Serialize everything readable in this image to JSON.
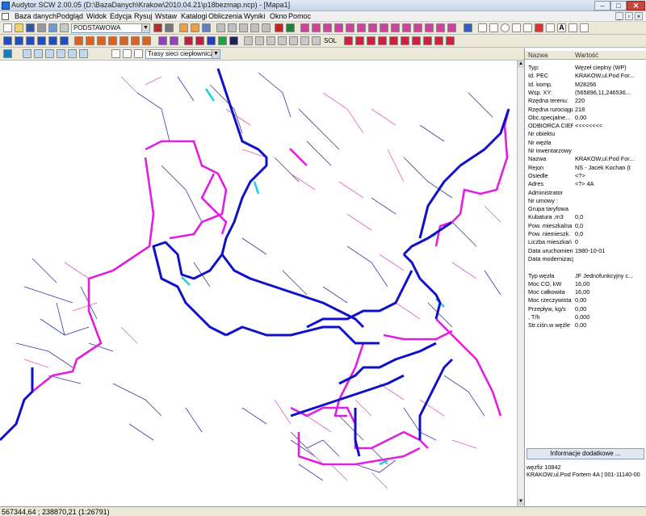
{
  "window": {
    "title": "Audytor SCW  2.00.05   (D:\\BazaDanych\\Krakow\\2010.04.21\\p18bezmap.ncp) - [Mapa1]",
    "minimize": "–",
    "maximize": "□",
    "close": "✕"
  },
  "menu": [
    "Baza danych",
    "Podgląd",
    "Widok",
    "Edycja",
    "Rysuj",
    "Wstaw",
    "Katalogi",
    "Obliczenia",
    "Wyniki",
    "Okno",
    "Pomoc"
  ],
  "toolbar": {
    "layer_select": "PODSTAWOWA",
    "zoom_label": "SOL",
    "trace_select": "Trasy sieci ciepłowniczej"
  },
  "props": {
    "header": {
      "name": "Nazwa",
      "value": "Wartość"
    },
    "rows": [
      {
        "k": "Typ:",
        "v": "Węzeł cieplny (WP)"
      },
      {
        "k": "Id. PEC",
        "v": "KRAKOW,ul.Pod For..."
      },
      {
        "k": "Id. komp.",
        "v": "M28266"
      },
      {
        "k": "Wsp. XY:",
        "v": "(565896,11,246536..."
      },
      {
        "k": "Rzędna terenu:",
        "v": "220"
      },
      {
        "k": "Rzędna rurociągu",
        "v": "218"
      },
      {
        "k": "Obc.specjalne...",
        "v": "0,00"
      },
      {
        "k": "ODBIORCA CIEPŁA",
        "v": "<<<<<<<<"
      },
      {
        "k": "Nr obiektu",
        "v": ""
      },
      {
        "k": "Nr węzła",
        "v": ""
      },
      {
        "k": "Nr inwentarzowy",
        "v": ""
      },
      {
        "k": "Nazwa",
        "v": "KRAKOW,ul.Pod For..."
      },
      {
        "k": "Rejon",
        "v": "NS - Jacek Kochan (t"
      },
      {
        "k": "Osiedle",
        "v": "<?>"
      },
      {
        "k": "Adres",
        "v": "<?> 4A"
      },
      {
        "k": "Administrator",
        "v": ""
      },
      {
        "k": "Nr umowy :",
        "v": ""
      },
      {
        "k": "Grupa taryfowa",
        "v": ""
      },
      {
        "k": "Kubatura ,m3",
        "v": "0,0"
      },
      {
        "k": "Pow. mieszkalna",
        "v": "0,0"
      },
      {
        "k": "Pow. niemieszk.",
        "v": "0,0"
      },
      {
        "k": "Liczba mieszkań",
        "v": "0"
      },
      {
        "k": "Data uruchomienia",
        "v": "1980-10-01"
      },
      {
        "k": "Data modernizacji",
        "v": ""
      },
      {
        "k": "",
        "v": ""
      },
      {
        "k": "Typ węzła",
        "v": "JF Jednofunkcyjny c..."
      },
      {
        "k": "Moc CO, kW",
        "v": "16,00"
      },
      {
        "k": "Moc całkowita",
        "v": "16,00"
      },
      {
        "k": "Moc rzeczywista",
        "v": "0,00"
      },
      {
        "k": "Przepływ, kg/s",
        "v": "0,00"
      },
      {
        "k": ", T/h",
        "v": "0,000"
      },
      {
        "k": "Str.ciśn.w węźle",
        "v": "0,00"
      }
    ],
    "info_button": "Informacje dodatkowe ...",
    "info_line1": "węzfiz 10842",
    "info_line2": "KRAKOW,ul.Pod Fortem 4A | 001-11140-00"
  },
  "status": {
    "coords": "567344,64 ; 238870,21  (1:26791)"
  },
  "colors": {
    "main_pipe": "#1010c8",
    "magenta_pipe": "#e020e0",
    "cyan_pipe": "#20d0e0",
    "service_line": "#3a3aa8",
    "pink_line": "#e060c0"
  }
}
